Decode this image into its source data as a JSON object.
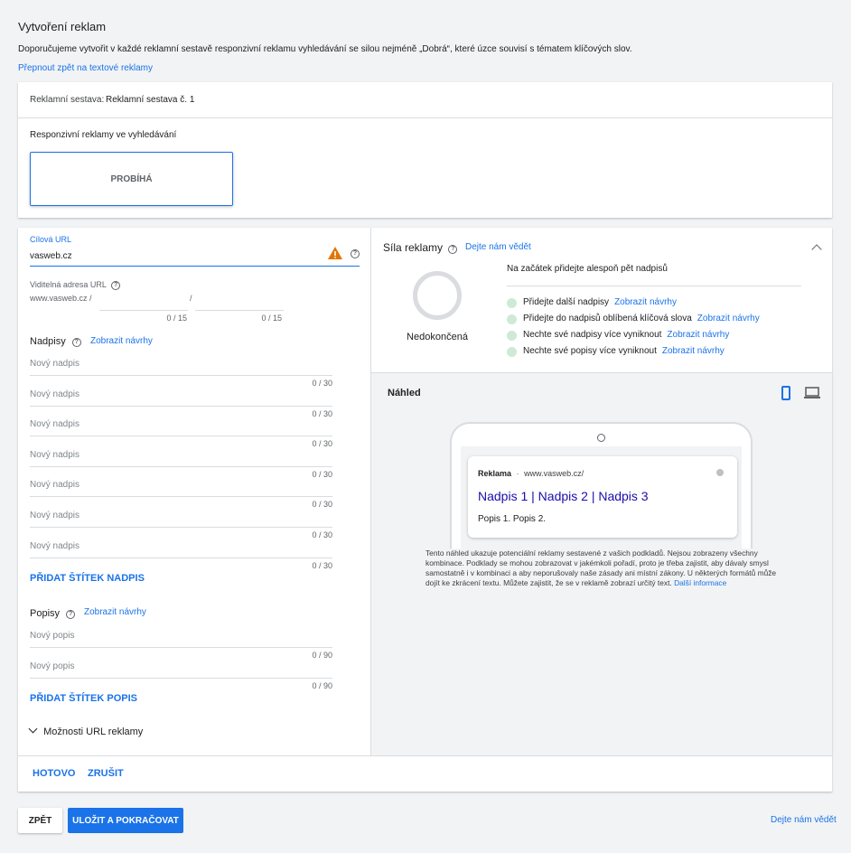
{
  "header": {
    "title": "Vytvoření reklam",
    "description": "Doporučujeme vytvořit v každé reklamní sestavě responzivní reklamu vyhledávání se silou nejméně „Dobrá“, které úzce souvisí s tématem klíčových slov.",
    "switch_link": "Přepnout zpět na textové reklamy"
  },
  "adgroup": {
    "label": "Reklamní sestava:",
    "value": "Reklamní sestava č. 1"
  },
  "rsa": {
    "title": "Responzivní reklamy ve vyhledávání",
    "status_box": "PROBÍHÁ"
  },
  "form": {
    "final_url_label": "Cílová URL",
    "final_url_value": "vasweb.cz",
    "display_url_label": "Viditelná adresa URL",
    "display_url_prefix": "www.vasweb.cz /",
    "display_url_sep": "/",
    "path1_counter": "0 / 15",
    "path2_counter": "0 / 15",
    "headlines_label": "Nadpisy",
    "headlines_suggest": "Zobrazit návrhy",
    "headline_placeholder": "Nový nadpis",
    "headline_counter": "0 / 30",
    "add_headline": "PŘIDAT ŠTÍTEK NADPIS",
    "descriptions_label": "Popisy",
    "descriptions_suggest": "Zobrazit návrhy",
    "description_placeholder": "Nový popis",
    "description_counter": "0 / 90",
    "add_description": "PŘIDAT ŠTÍTEK POPIS",
    "url_options": "Možnosti URL reklamy"
  },
  "strength": {
    "title": "Síla reklamy",
    "feedback_link": "Dejte nám vědět",
    "status": "Nedokončená",
    "intro": "Na začátek přidejte alespoň pět nadpisů",
    "items": [
      {
        "text": "Přidejte další nadpisy",
        "link": "Zobrazit návrhy"
      },
      {
        "text": "Přidejte do nadpisů oblíbená klíčová slova",
        "link": "Zobrazit návrhy"
      },
      {
        "text": "Nechte své nadpisy více vyniknout",
        "link": "Zobrazit návrhy"
      },
      {
        "text": "Nechte své popisy více vyniknout",
        "link": "Zobrazit návrhy"
      }
    ]
  },
  "preview": {
    "title": "Náhled",
    "ad_badge": "Reklama",
    "ad_url": "www.vasweb.cz/",
    "ad_headline": "Nadpis 1 | Nadpis 2 | Nadpis 3",
    "ad_description": "Popis 1. Popis 2.",
    "note": "Tento náhled ukazuje potenciální reklamy sestavené z vašich podkladů. Nejsou zobrazeny všechny kombinace. Podklady se mohou zobrazovat v jakémkoli pořadí, proto je třeba zajistit, aby dávaly smysl samostatně i v kombinaci a aby neporušovaly naše zásady ani místní zákony. U některých formátů může dojít ke zkrácení textu. Můžete zajistit, že se v reklamě zobrazí určitý text.",
    "more_link": "Další informace"
  },
  "actions": {
    "done": "HOTOVO",
    "cancel": "ZRUŠIT"
  },
  "footer": {
    "back": "ZPĚT",
    "save": "ULOŽIT A POKRAČOVAT",
    "feedback": "Dejte nám vědět"
  },
  "colors": {
    "accent": "#1a73e8",
    "warning": "#e37400",
    "success_light": "#ceead6"
  }
}
